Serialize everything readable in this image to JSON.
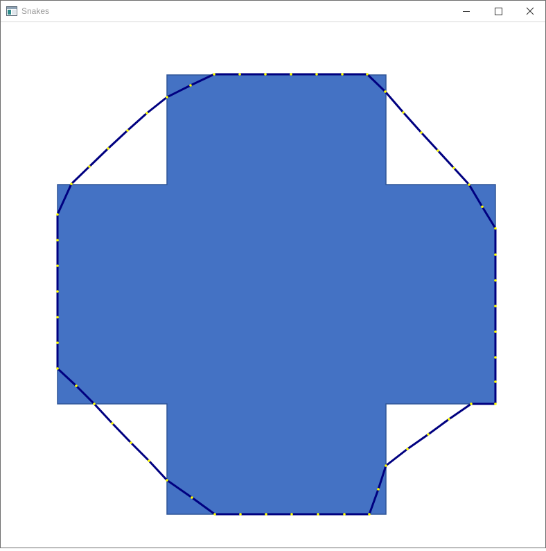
{
  "window": {
    "title": "Snakes"
  },
  "colors": {
    "shape_fill": "#4472c4",
    "shape_stroke": "#2f5597",
    "snake_line": "#000080",
    "snake_points": "#ffff00"
  },
  "icons": {
    "app": "app-window-icon",
    "minimize": "minimize-icon",
    "maximize": "maximize-icon",
    "close": "close-icon"
  }
}
